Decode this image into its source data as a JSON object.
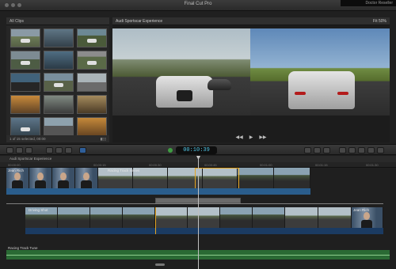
{
  "window": {
    "title": "Final Cut Pro",
    "corner_text": "Doctor Reseller"
  },
  "browser": {
    "header": "All Clips",
    "footer_left": "1 of 15 selected, 00:00",
    "footer_right": "▮▯▯"
  },
  "viewer": {
    "header": "Audi Sportscar Experience",
    "header_right": "Fit  50%"
  },
  "toolbar": {
    "timecode": "00:10:39"
  },
  "timeline": {
    "header": "Audi Sportscar Experience",
    "ruler_marks": [
      "00:00:00",
      "00:00:15",
      "00:00:30",
      "00:00:45",
      "00:01:00",
      "00:01:15",
      "00:01:30"
    ],
    "clip_labels": {
      "interview": "Jean Rich",
      "broll": "Racing Track Series",
      "driving": "Driving Shot",
      "interview_end": "Jean Rich"
    },
    "audio_label": "Racing Track Tune"
  }
}
